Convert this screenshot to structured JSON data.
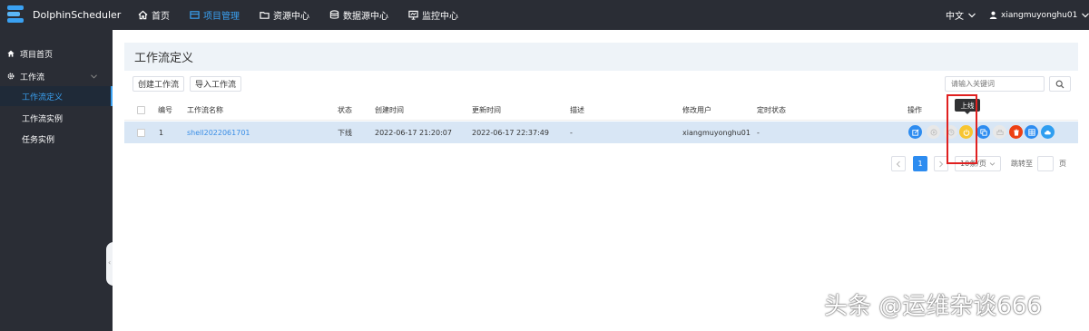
{
  "app": {
    "name": "DolphinScheduler"
  },
  "nav": [
    {
      "label": "首页",
      "icon": "home-icon"
    },
    {
      "label": "项目管理",
      "icon": "project-icon",
      "active": true
    },
    {
      "label": "资源中心",
      "icon": "folder-icon"
    },
    {
      "label": "数据源中心",
      "icon": "database-icon"
    },
    {
      "label": "监控中心",
      "icon": "monitor-icon"
    }
  ],
  "header": {
    "language": "中文",
    "username": "xiangmuyonghu01"
  },
  "sidebar": {
    "home": "项目首页",
    "workflow_group": "工作流",
    "items": [
      "工作流定义",
      "工作流实例",
      "任务实例"
    ],
    "active_index": 0
  },
  "page": {
    "title": "工作流定义",
    "create_button": "创建工作流",
    "import_button": "导入工作流",
    "search_placeholder": "请输入关键词"
  },
  "table": {
    "headers": [
      "编号",
      "工作流名称",
      "状态",
      "创建时间",
      "更新时间",
      "描述",
      "修改用户",
      "定时状态",
      "操作"
    ],
    "rows": [
      {
        "id": "1",
        "name": "shell2022061701",
        "status": "下线",
        "created": "2022-06-17 21:20:07",
        "updated": "2022-06-17 22:37:49",
        "description": "-",
        "modifier": "xiangmuyonghu01",
        "schedule_status": "-"
      }
    ],
    "tooltip": "上线"
  },
  "pagination": {
    "current_page": "1",
    "page_size": "10条/页",
    "goto_label": "跳转至",
    "page_unit": "页"
  },
  "colors": {
    "accent": "#2d8cf0",
    "sidebar_bg": "#2a2d35",
    "highlight_box": "#e02020"
  },
  "watermark": "头条 @运维杂谈666"
}
